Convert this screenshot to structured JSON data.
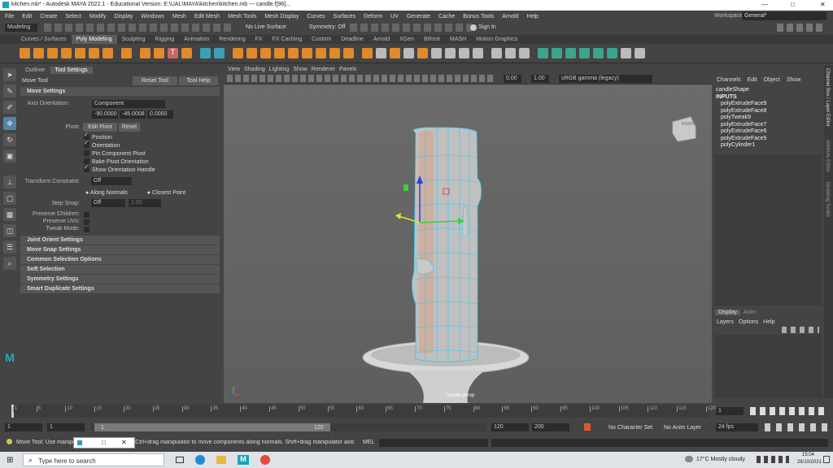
{
  "window": {
    "title": "kitchen.mb* - Autodesk MAYA 2022.1 - Educational Version: E:\\UAL\\MAYA\\kitchen\\kitchen.mb  ---  candle.f[96]...",
    "minimize": "—",
    "maximize": "□",
    "close": "✕"
  },
  "menu": [
    "File",
    "Edit",
    "Create",
    "Select",
    "Modify",
    "Display",
    "Windows",
    "Mesh",
    "Edit Mesh",
    "Mesh Tools",
    "Mesh Display",
    "Curves",
    "Surfaces",
    "Deform",
    "UV",
    "Generate",
    "Cache",
    "Bonus Tools",
    "Arnold",
    "Help"
  ],
  "workspace": {
    "label": "Workspace :",
    "value": "General*"
  },
  "status": {
    "mode": "Modeling",
    "live": "No Live Surface",
    "symmetry": "Symmetry: Off",
    "signin": "Sign In"
  },
  "shelf_tabs": [
    "Curves / Surfaces",
    "Poly Modeling",
    "Sculpting",
    "Rigging",
    "Animation",
    "Rendering",
    "FX",
    "FX Caching",
    "Custom",
    "Deadline",
    "Arnold",
    "XGen",
    "Bifrost",
    "MASH",
    "Motion Graphics"
  ],
  "shelf_active": "Poly Modeling",
  "panel": {
    "tabs": [
      "Outliner",
      "Tool Settings"
    ],
    "tool_name": "Move Tool",
    "reset_tool": "Reset Tool",
    "tool_help": "Tool Help",
    "move_settings": "Move Settings",
    "axis_orientation_label": "Axis Orientation:",
    "axis_orientation_value": "Component",
    "axis_values": [
      "-90.0000",
      "-45.0008",
      "0.0000"
    ],
    "pivot_label": "Pivot:",
    "edit_pivot": "Edit Pivot",
    "reset": "Reset",
    "checks": [
      {
        "label": "Position",
        "on": true
      },
      {
        "label": "Orientation",
        "on": true
      },
      {
        "label": "Pin Component Pivot",
        "on": false
      },
      {
        "label": "Bake Pivot Orientation",
        "on": false
      },
      {
        "label": "Show Orientation Handle",
        "on": true
      }
    ],
    "transform_constraint_label": "Transform Constraint:",
    "transform_constraint_value": "Off",
    "along_normals": "Along Normals",
    "closest_point": "Closest Point",
    "step_snap_label": "Step Snap:",
    "step_snap_value": "Off",
    "step_snap_num": "1.00",
    "preserve_children": "Preserve Children:",
    "preserve_uvs": "Preserve UVs:",
    "tweak_mode": "Tweak Mode:",
    "sections": [
      "Joint Orient Settings",
      "Move Snap Settings",
      "Common Selection Options",
      "Soft Selection",
      "Symmetry Settings",
      "Smart Duplicate Settings"
    ]
  },
  "viewport": {
    "menu": [
      "View",
      "Shading",
      "Lighting",
      "Show",
      "Renderer",
      "Panels"
    ],
    "field_a": "0.00",
    "field_b": "1.00",
    "colorspace": "sRGB gamma (legacy)",
    "cube_label": "RIGHT",
    "camera_label": "Isolate   persp"
  },
  "channel": {
    "menu": [
      "Channels",
      "Edit",
      "Object",
      "Show"
    ],
    "shape": "candleShape",
    "inputs_label": "INPUTS",
    "inputs": [
      "polyExtrudeFace9",
      "polyExtrudeFace8",
      "polyTweak9",
      "polyExtrudeFace7",
      "polyExtrudeFace6",
      "polyExtrudeFace5",
      "polyCylinder1"
    ],
    "layer_tabs": [
      "Display",
      "Anim"
    ],
    "layer_menu": [
      "Layers",
      "Options",
      "Help"
    ]
  },
  "side_tabs": [
    "Channel Box / Layer Editor",
    "Attribute Editor",
    "Modeling Toolkit"
  ],
  "timeline": {
    "ticks": [
      "1",
      "5",
      "10",
      "15",
      "20",
      "25",
      "30",
      "35",
      "40",
      "45",
      "50",
      "55",
      "60",
      "65",
      "70",
      "75",
      "80",
      "85",
      "90",
      "95",
      "100",
      "105",
      "110",
      "115",
      "120"
    ],
    "current": "1"
  },
  "range": {
    "start": "1",
    "start2": "1",
    "slider_start": "1",
    "slider_end": "120",
    "end": "120",
    "end2": "200",
    "character_set": "No Character Set",
    "anim_layer": "No Anim Layer",
    "fps": "24 fps"
  },
  "cmd": {
    "help": "Move Tool: Use manipulator to move object(s). Ctrl+drag manipulator to move components along normals. Shift+drag manipulator axis or plane handles to extrude components or c",
    "mel": "MEL"
  },
  "taskbar": {
    "search": "Type here to search",
    "weather": "17°C  Mostly cloudy",
    "time": "15:04",
    "date": "26/10/2021"
  }
}
